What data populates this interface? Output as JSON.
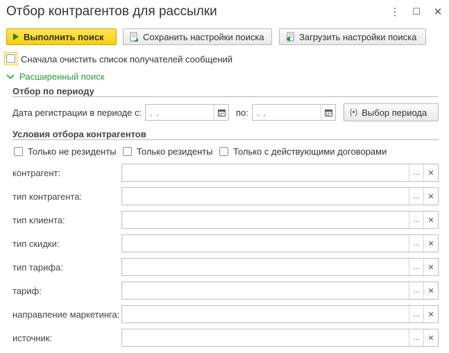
{
  "window": {
    "title": "Отбор контрагентов для рассылки",
    "controls": {
      "more": "⋮",
      "maximize": "☐",
      "close": "✕"
    }
  },
  "toolbar": {
    "run_search": "Выполнить поиск",
    "save_settings": "Сохранить настройки поиска",
    "load_settings": "Загрузить настройки поиска"
  },
  "clear_recipients": {
    "label": "Сначала очистить список получателей сообщений",
    "checked": false
  },
  "advanced_search": {
    "label": "Расширенный поиск",
    "expanded": true
  },
  "period": {
    "heading": "Отбор по периоду",
    "date_label": "Дата регистрации в периоде с:",
    "from_value": ". .",
    "to_label": "по:",
    "to_value": ". .",
    "choose_period": "Выбор периода"
  },
  "conditions": {
    "heading": "Условия отбора контрагентов",
    "checkboxes": [
      {
        "label": "Только не резиденты",
        "checked": false
      },
      {
        "label": "Только резиденты",
        "checked": false
      },
      {
        "label": "Только с действующими договорами",
        "checked": false
      }
    ],
    "fields": [
      {
        "label": "контрагент:",
        "value": ""
      },
      {
        "label": "тип контрагента:",
        "value": ""
      },
      {
        "label": "тип клиента:",
        "value": ""
      },
      {
        "label": "тип скидки:",
        "value": ""
      },
      {
        "label": "тип тарифа:",
        "value": ""
      },
      {
        "label": "тариф:",
        "value": ""
      },
      {
        "label": "направление маркетинга:",
        "value": ""
      },
      {
        "label": "источник:",
        "value": ""
      }
    ],
    "pick_glyph": "...",
    "clear_glyph": "✕"
  },
  "colors": {
    "accent_green": "#2a9c3c",
    "primary_button": "#f7cf0e"
  }
}
